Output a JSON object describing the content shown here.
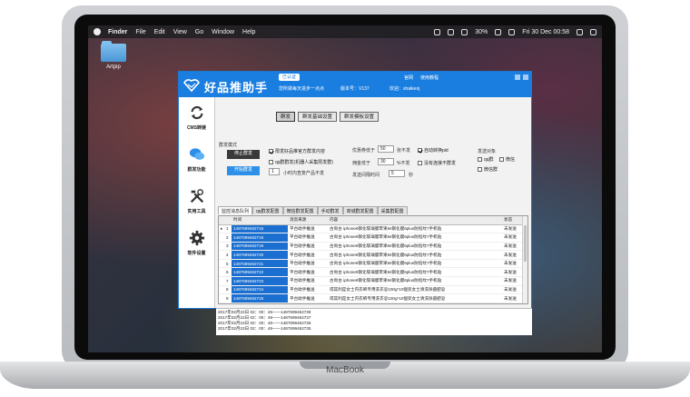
{
  "menubar": {
    "app": "Finder",
    "items": [
      "File",
      "Edit",
      "View",
      "Go",
      "Window",
      "Help"
    ],
    "battery": "30%",
    "clock": "Fri 30 Dec  00:58"
  },
  "desktop": {
    "folder_label": "Artpip"
  },
  "laptop": {
    "brand": "MacBook"
  },
  "app": {
    "title": "好品推助手",
    "activated": "已认证",
    "header_links": [
      "官网",
      "使用教程"
    ],
    "subtitle": "您所做每天进步一点点",
    "version": "版本号：V137",
    "welcome": "欢迎：shaikeoj",
    "sidebar": [
      {
        "label": "CMS转链",
        "icon": "refresh-icon"
      },
      {
        "label": "群发功能",
        "icon": "wechat-icon"
      },
      {
        "label": "实用工具",
        "icon": "tools-icon"
      },
      {
        "label": "软件设置",
        "icon": "gear-icon"
      }
    ],
    "tabs": [
      "群发",
      "群发基础设置",
      "群发模板设置"
    ],
    "mode": {
      "label": "群发模式",
      "stop_button": "停止群发",
      "start_button": "开始群发",
      "opt_official": "限发好品推官方群发内容",
      "opt_qq": "qq群群发(机器人采集限发群)",
      "hours_value": "1",
      "hours_label": "小时内查复产品不发",
      "coupon_label": "优惠券低于",
      "coupon_value": "50",
      "coupon_unit": "张不发",
      "commission_label": "佣金低于",
      "commission_value": "30",
      "commission_unit": "%不发",
      "interval_label": "发送间隔时间",
      "interval_value": "5",
      "interval_unit": "秒",
      "auto_convert": "自动转换pid",
      "no_link": "没有连接不群发",
      "targets_label": "发送对象",
      "targets": [
        "qq群",
        "微信",
        "微信群"
      ]
    },
    "subtabs": [
      "监控消息队列",
      "qq群发配置",
      "微信群发配置",
      "手动群发",
      "商城群发配置",
      "采集群配置"
    ],
    "table": {
      "headers": [
        "",
        "",
        "时间",
        "消息来源",
        "内容",
        "状态"
      ],
      "rows": [
        {
          "n": "1",
          "time": "1487699462716",
          "src": "平台助手推送",
          "content": "古尚古 iphone6钢化玻璃膜苹果6s钢化膜6plus防指纹7手机贴",
          "status": "未发送"
        },
        {
          "n": "2",
          "time": "1487699462718",
          "src": "平台助手推送",
          "content": "古尚古 iphone6钢化玻璃膜苹果6s钢化膜6plus防指纹7手机贴",
          "status": "未发送"
        },
        {
          "n": "3",
          "time": "1487699462719",
          "src": "平台助手推送",
          "content": "古尚古 iphone6钢化玻璃膜苹果6s钢化膜6plus防指纹7手机贴",
          "status": "未发送"
        },
        {
          "n": "4",
          "time": "1487699462720",
          "src": "平台助手推送",
          "content": "古尚古 iphone6钢化玻璃膜苹果6s钢化膜6plus防指纹7手机贴",
          "status": "未发送"
        },
        {
          "n": "5",
          "time": "1487699462721",
          "src": "平台助手推送",
          "content": "古尚古 iphone6钢化玻璃膜苹果6s钢化膜6plus防指纹7手机贴",
          "status": "未发送"
        },
        {
          "n": "6",
          "time": "1487699462722",
          "src": "平台助手推送",
          "content": "古尚古 iphone6钢化玻璃膜苹果6s钢化膜6plus防指纹7手机贴",
          "status": "未发送"
        },
        {
          "n": "7",
          "time": "1487699462723",
          "src": "平台助手推送",
          "content": "古尚古 iphone6钢化玻璃膜苹果6s钢化膜6plus防指纹7手机贴",
          "status": "未发送"
        },
        {
          "n": "8",
          "time": "1487699462724",
          "src": "平台助手推送",
          "content": "得其利是女士内衣裤专用洗衣皂100g*10個装女士清洗除菌肥皂",
          "status": "未发送"
        },
        {
          "n": "9",
          "time": "1487699462725",
          "src": "平台助手推送",
          "content": "得其利是女士内衣裤专用洗衣皂100g*10個装女士清洗除菌肥皂",
          "status": "未发送"
        }
      ]
    },
    "log": [
      "2017年02月22日 02：00：46——1487699462738",
      "2017年02月22日 02：00：46——1487699462737",
      "2017年02月22日 02：00：46——1487699462736",
      "2017年02月22日 02：00：46——1487699462735"
    ]
  }
}
